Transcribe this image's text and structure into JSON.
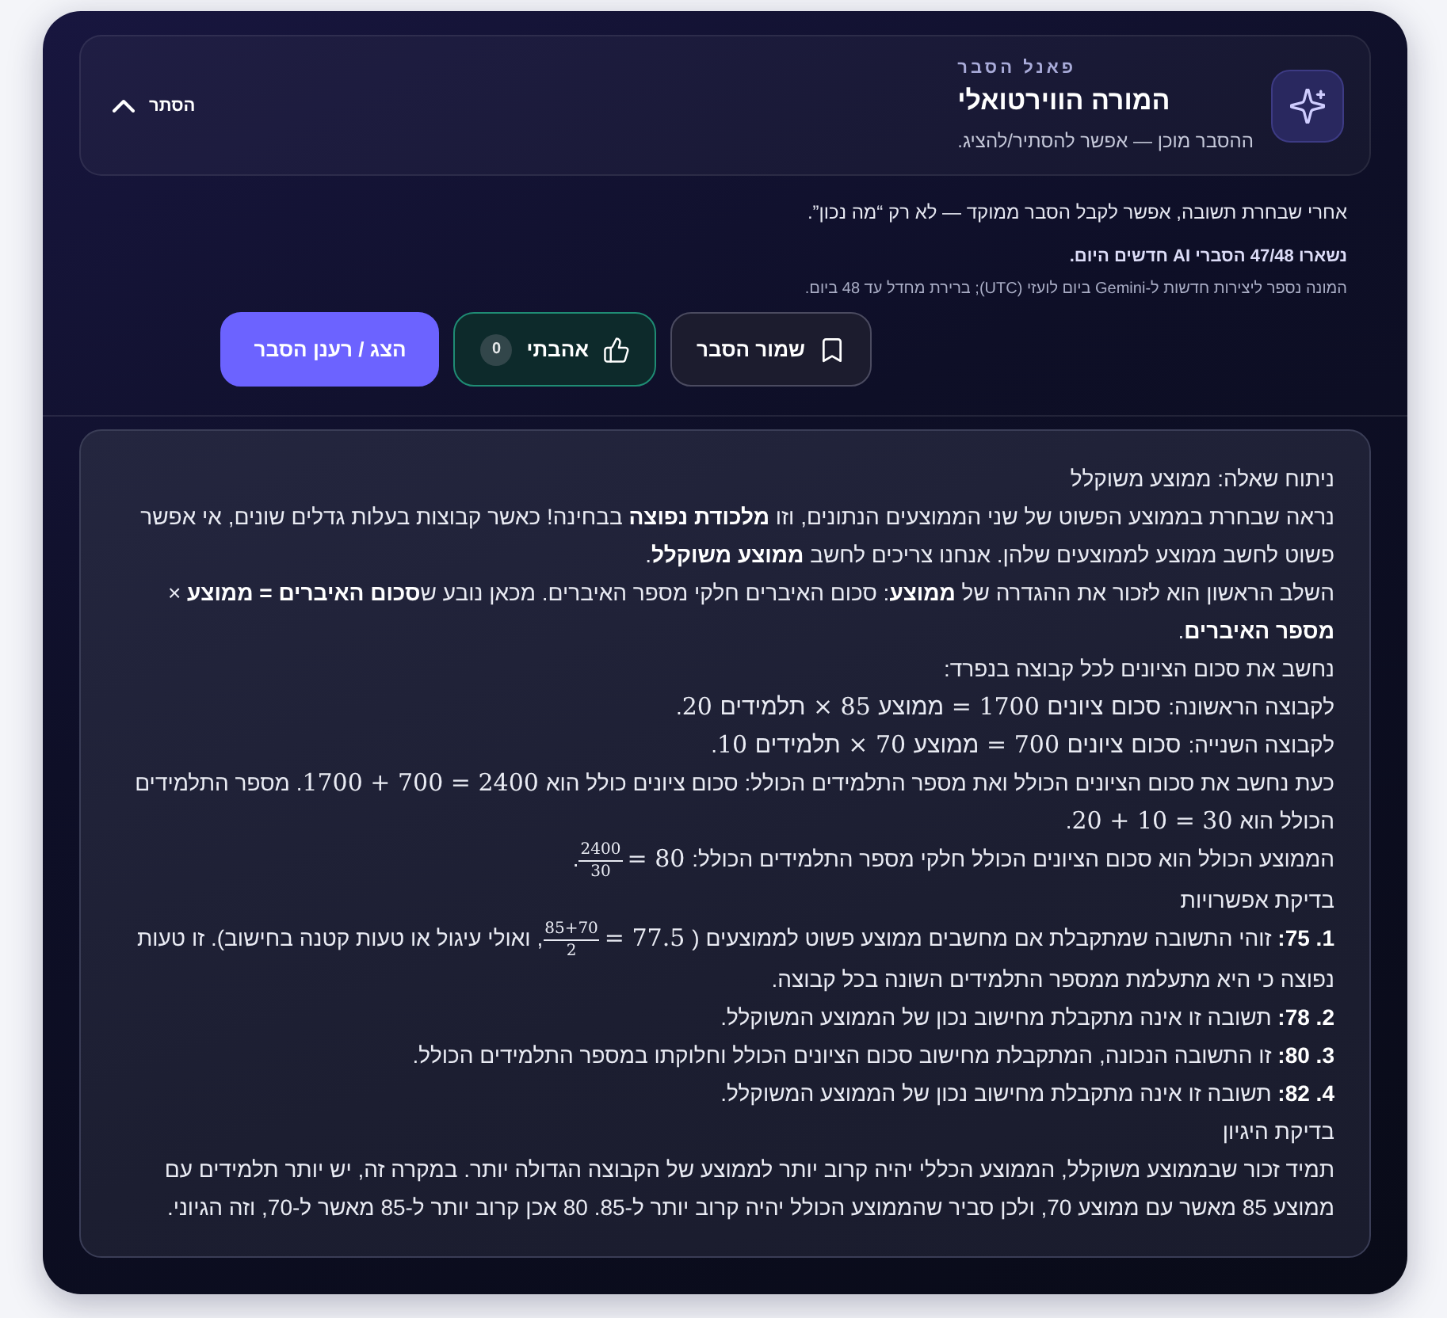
{
  "panel": {
    "eyebrow": "פאנל הסבר",
    "title": "המורה הווירטואלי",
    "subtitle": "ההסבר מוכן — אפשר להסתיר/להציג.",
    "toggle": {
      "label": "הסתר",
      "expanded": true
    }
  },
  "info": {
    "intro": "אחרי שבחרת תשובה, אפשר לקבל הסבר ממוקד — לא רק “מה נכון”.",
    "quota": "נשארו 47/48 הסברי AI חדשים היום.",
    "note": "המונה נספר ליצירות חדשות ל-Gemini ביום לועזי (UTC); ברירת מחדל עד 48 ביום."
  },
  "actions": [
    {
      "kind": "save",
      "label": "שמור הסבר"
    },
    {
      "kind": "like",
      "label": "אהבתי",
      "count": "0"
    },
    {
      "kind": "primary",
      "label": "הצג / רענן הסבר"
    }
  ],
  "explanation": [
    {
      "segments": [
        {
          "kind": "text",
          "text": "ניתוח שאלה: ממוצע משוקלל"
        }
      ]
    },
    {
      "segments": [
        {
          "kind": "text",
          "text": "נראה שבחרת בממוצע הפשוט של שני הממוצעים הנתונים, וזו **מלכודת נפוצה** בבחינה! כאשר קבוצות בעלות גדלים שונים, אי אפשר פשוט לחשב ממוצע לממוצעים שלהן. אנחנו צריכים לחשב **ממוצע משוקלל**."
        }
      ]
    },
    {
      "segments": [
        {
          "kind": "text",
          "text": "השלב הראשון הוא לזכור את ההגדרה של **ממוצע**: סכום האיברים חלקי מספר האיברים. מכאן נובע ש**סכום האיברים = ממוצע** × **מספר האיברים**."
        }
      ]
    },
    {
      "segments": [
        {
          "kind": "text",
          "text": "נחשב את סכום הציונים לכל קבוצה בנפרד:"
        }
      ]
    },
    {
      "segments": [
        {
          "kind": "text",
          "text": "לקבוצה הראשונה:"
        },
        {
          "kind": "math",
          "text": "סכום ציונים 1700 = ממוצע 85 × תלמידים 20"
        },
        {
          "kind": "text",
          "text": "."
        }
      ]
    },
    {
      "segments": [
        {
          "kind": "text",
          "text": "לקבוצה השנייה:"
        },
        {
          "kind": "math",
          "text": "סכום ציונים 700 = ממוצע 70 × תלמידים 10"
        },
        {
          "kind": "text",
          "text": "."
        }
      ]
    },
    {
      "segments": [
        {
          "kind": "text",
          "text": "כעת נחשב את סכום הציונים הכולל ואת מספר התלמידים הכולל: סכום ציונים כולל הוא"
        },
        {
          "kind": "math",
          "text": "2400 = 700 + 1700"
        },
        {
          "kind": "text",
          "text": ". מספר התלמידים הכולל הוא"
        },
        {
          "kind": "math",
          "text": "30 = 10 + 20"
        },
        {
          "kind": "text",
          "text": "."
        }
      ]
    },
    {
      "segments": [
        {
          "kind": "text",
          "text": "הממוצע הכולל הוא סכום הציונים הכולל חלקי מספר התלמידים הכולל:"
        },
        {
          "kind": "math",
          "text": "80 ="
        },
        {
          "kind": "frac",
          "num": "2400",
          "den": "30"
        },
        {
          "kind": "text",
          "text": "."
        }
      ]
    },
    {
      "segments": [
        {
          "kind": "text",
          "text": "בדיקת אפשרויות"
        }
      ]
    },
    {
      "segments": [
        {
          "kind": "text",
          "text": "**1. 75:** זוהי התשובה שמתקבלת אם מחשבים ממוצע פשוט לממוצעים ("
        },
        {
          "kind": "math",
          "text": "77.5 ="
        },
        {
          "kind": "frac",
          "num": "85+70",
          "den": "2"
        },
        {
          "kind": "text",
          "text": ", ואולי עיגול או טעות קטנה בחישוב). זו טעות נפוצה כי היא מתעלמת ממספר התלמידים השונה בכל קבוצה."
        }
      ]
    },
    {
      "segments": [
        {
          "kind": "text",
          "text": "**2. 78:** תשובה זו אינה מתקבלת מחישוב נכון של הממוצע המשוקלל."
        }
      ]
    },
    {
      "segments": [
        {
          "kind": "text",
          "text": "**3. 80:** זו התשובה הנכונה, המתקבלת מחישוב סכום הציונים הכולל וחלוקתו במספר התלמידים הכולל."
        }
      ]
    },
    {
      "segments": [
        {
          "kind": "text",
          "text": "**4. 82:** תשובה זו אינה מתקבלת מחישוב נכון של הממוצע המשוקלל."
        }
      ]
    },
    {
      "segments": [
        {
          "kind": "text",
          "text": "בדיקת היגיון"
        }
      ]
    },
    {
      "segments": [
        {
          "kind": "text",
          "text": "תמיד זכור שבממוצע משוקלל, הממוצע הכללי יהיה קרוב יותר לממוצע של הקבוצה הגדולה יותר. במקרה זה, יש יותר תלמידים עם ממוצע 85 מאשר עם ממוצע 70, ולכן סביר שהממוצע הכולל יהיה קרוב יותר ל-85. 80 אכן קרוב יותר ל-85 מאשר ל-70, וזה הגיוני."
        }
      ]
    }
  ]
}
